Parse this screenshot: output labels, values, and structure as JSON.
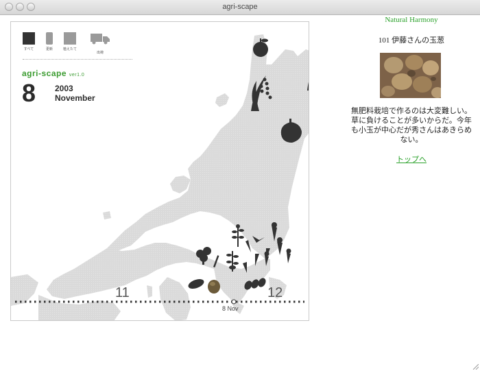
{
  "window": {
    "title": "agri-scape"
  },
  "toolbar": {
    "modes": [
      {
        "label": "すべて",
        "icon": "grid-icon",
        "selected": true
      },
      {
        "label": "更新",
        "icon": "phone-icon",
        "selected": false
      },
      {
        "label": "植えたて",
        "icon": "square-icon",
        "selected": false
      },
      {
        "label": "出荷",
        "icon": "truck-icon",
        "selected": false
      }
    ]
  },
  "app": {
    "name": "agri-scape",
    "version": "ver1.0"
  },
  "date": {
    "day": "8",
    "year": "2003",
    "month": "November"
  },
  "timeline": {
    "left_tick": "11",
    "right_tick": "12",
    "cursor_label": "8 Nov"
  },
  "sidebar": {
    "brand": "Natural Harmony",
    "item_title": "101 伊藤さんの玉葱",
    "description": "無肥料栽培で作るのは大変難しい。草に負けることが多いからだ。今年も小玉が中心だが秀さんはあきらめない。",
    "top_link": "トップへ"
  },
  "colors": {
    "accent_green": "#3a9b2f",
    "link_green": "#2aa12a",
    "map_gray": "#d9d9d9",
    "icon_dark": "#333333"
  },
  "map_icons": [
    "apple-icon",
    "rice-icon",
    "rice-icon",
    "onion-icon",
    "broccoli-icon",
    "leek-icon",
    "carrot-icon",
    "daikon-icon",
    "sweet-potato-icon",
    "potato-icon",
    "taro-icon",
    "herb-icon"
  ]
}
